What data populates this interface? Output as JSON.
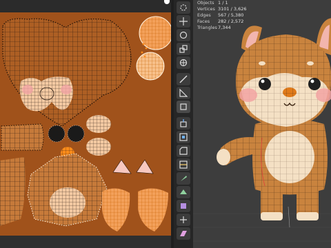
{
  "stats": [
    {
      "label": "Objects",
      "value": "1 / 1"
    },
    {
      "label": "Vertices",
      "value": "3101 / 3,626"
    },
    {
      "label": "Edges",
      "value": "567 / 5,380"
    },
    {
      "label": "Faces",
      "value": "282 / 2,572"
    },
    {
      "label": "Triangles",
      "value": "7,344"
    }
  ],
  "tools": [
    {
      "name": "cursor-icon"
    },
    {
      "name": "move-icon"
    },
    {
      "name": "rotate-icon"
    },
    {
      "name": "scale-icon"
    },
    {
      "name": "transform-icon"
    },
    {
      "name": "annotate-icon"
    },
    {
      "name": "measure-icon"
    },
    {
      "name": "add-cube-icon"
    },
    {
      "name": "extrude-icon"
    },
    {
      "name": "inset-icon"
    },
    {
      "name": "bevel-icon"
    },
    {
      "name": "loop-cut-icon"
    },
    {
      "name": "knife-icon"
    },
    {
      "name": "poly-build-icon"
    },
    {
      "name": "spin-icon"
    },
    {
      "name": "smooth-icon"
    },
    {
      "name": "edge-slide-icon"
    },
    {
      "name": "shrink-fatten-icon"
    },
    {
      "name": "shear-icon"
    },
    {
      "name": "rip-region-icon"
    }
  ],
  "colors": {
    "uv_background": "#a0521b",
    "mesh_fill": "#f3c9a2",
    "mesh_line": "#2a1a10",
    "selected_vertex": "#ff8c1a",
    "viewport_bg": "#3d3d3d",
    "model_fur": "#c9833e",
    "model_belly": "#f4e0c4"
  }
}
